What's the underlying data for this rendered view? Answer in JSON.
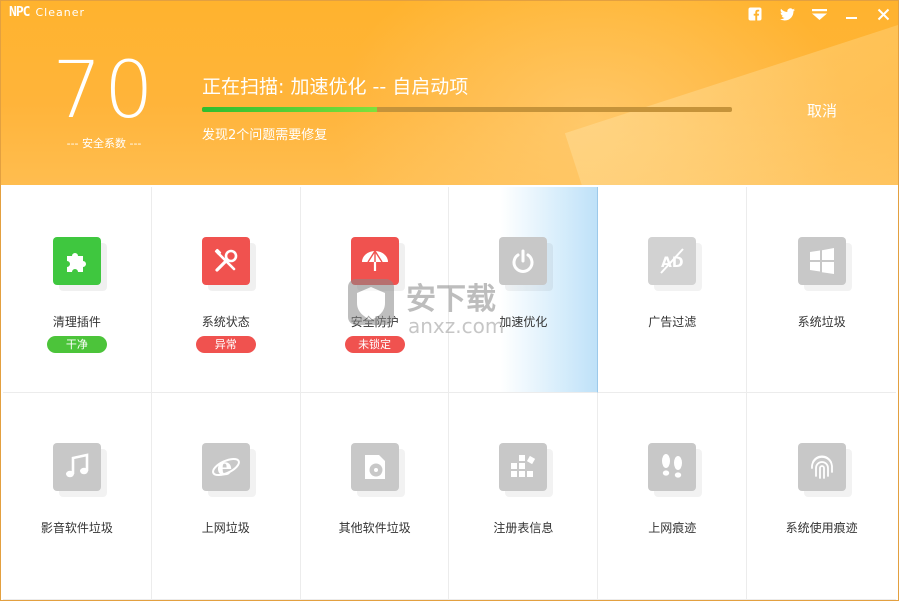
{
  "app": {
    "logo_mark": "NPC",
    "logo_text": "Cleaner"
  },
  "topbar": [
    "facebook-icon",
    "twitter-icon",
    "menu-icon",
    "minimize-icon",
    "close-icon"
  ],
  "score": {
    "value": "70",
    "label": "--- 安全系数 ---"
  },
  "scan": {
    "title": "正在扫描: 加速优化 -- 自启动项",
    "subtitle": "发现2个问题需要修复",
    "progress": 0.33,
    "cancel_label": "取消"
  },
  "tiles_row1": [
    {
      "name": "清理插件",
      "icon": "puzzle-icon",
      "color": "#3fc73f",
      "badge": "干净",
      "badge_color": "#4cc43a"
    },
    {
      "name": "系统状态",
      "icon": "tools-icon",
      "color": "#f0524f",
      "badge": "异常",
      "badge_color": "#f0524f"
    },
    {
      "name": "安全防护",
      "icon": "umbrella-icon",
      "color": "#f0524f",
      "badge": "未锁定",
      "badge_color": "#f0524f"
    },
    {
      "name": "加速优化",
      "icon": "power-icon",
      "color": "#c8c8c8"
    },
    {
      "name": "广告过滤",
      "icon": "ad-block-icon",
      "color": "#d2d2d2"
    },
    {
      "name": "系统垃圾",
      "icon": "windows-icon",
      "color": "#c8c8c8"
    }
  ],
  "tiles_row2": [
    {
      "name": "影音软件垃圾",
      "icon": "music-icon",
      "color": "#c8c8c8"
    },
    {
      "name": "上网垃圾",
      "icon": "browser-icon",
      "color": "#c8c8c8"
    },
    {
      "name": "其他软件垃圾",
      "icon": "disc-icon",
      "color": "#c8c8c8"
    },
    {
      "name": "注册表信息",
      "icon": "registry-icon",
      "color": "#c8c8c8"
    },
    {
      "name": "上网痕迹",
      "icon": "footprints-icon",
      "color": "#c8c8c8"
    },
    {
      "name": "系统使用痕迹",
      "icon": "fingerprint-icon",
      "color": "#c8c8c8"
    }
  ],
  "watermark": {
    "text_cn": "安下载",
    "text_en": "anxz.com"
  }
}
